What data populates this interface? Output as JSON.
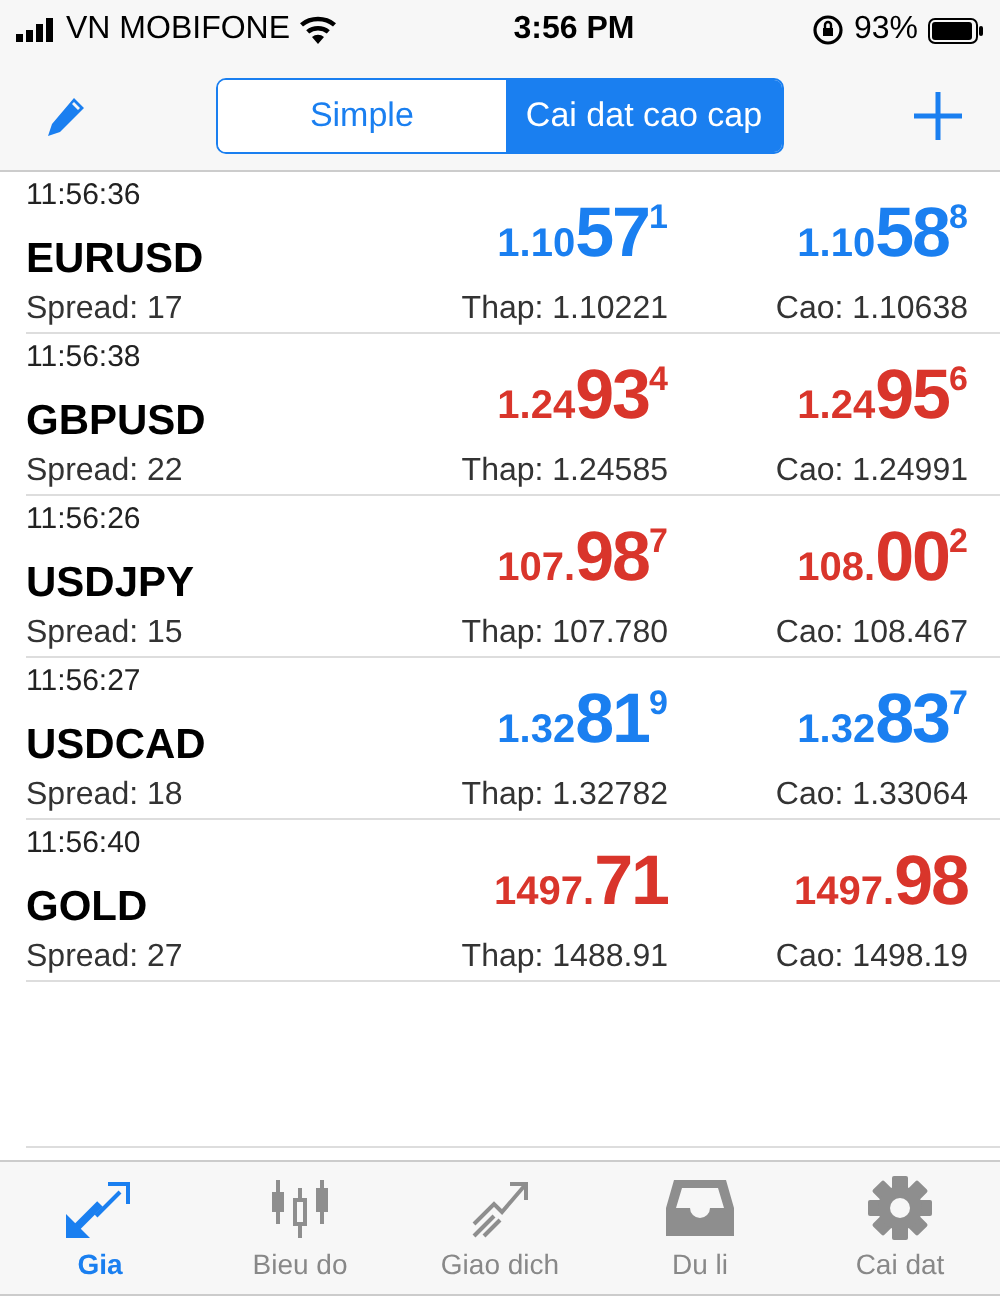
{
  "status_bar": {
    "carrier": "VN MOBIFONE",
    "time": "3:56 PM",
    "battery": "93%"
  },
  "toolbar": {
    "segments": [
      {
        "label": "Simple",
        "selected": false
      },
      {
        "label": "Cai dat cao cap",
        "selected": true
      }
    ]
  },
  "quotes": [
    {
      "time": "11:56:36",
      "symbol": "EURUSD",
      "spread": "Spread: 17",
      "color": "#1a7ff0",
      "bid": {
        "head": "1.10",
        "big": "57",
        "tail": "1"
      },
      "ask": {
        "head": "1.10",
        "big": "58",
        "tail": "8"
      },
      "low": "Thap: 1.10221",
      "high": "Cao: 1.10638"
    },
    {
      "time": "11:56:38",
      "symbol": "GBPUSD",
      "spread": "Spread: 22",
      "color": "#d9352b",
      "bid": {
        "head": "1.24",
        "big": "93",
        "tail": "4"
      },
      "ask": {
        "head": "1.24",
        "big": "95",
        "tail": "6"
      },
      "low": "Thap: 1.24585",
      "high": "Cao: 1.24991"
    },
    {
      "time": "11:56:26",
      "symbol": "USDJPY",
      "spread": "Spread: 15",
      "color": "#d9352b",
      "bid": {
        "head": "107.",
        "big": "98",
        "tail": "7"
      },
      "ask": {
        "head": "108.",
        "big": "00",
        "tail": "2"
      },
      "low": "Thap: 107.780",
      "high": "Cao: 108.467"
    },
    {
      "time": "11:56:27",
      "symbol": "USDCAD",
      "spread": "Spread: 18",
      "color": "#1a7ff0",
      "bid": {
        "head": "1.32",
        "big": "81",
        "tail": "9"
      },
      "ask": {
        "head": "1.32",
        "big": "83",
        "tail": "7"
      },
      "low": "Thap: 1.32782",
      "high": "Cao: 1.33064"
    },
    {
      "time": "11:56:40",
      "symbol": "GOLD",
      "spread": "Spread: 27",
      "color": "#d9352b",
      "bid": {
        "head": "1497.",
        "big": "71"
      },
      "ask": {
        "head": "1497.",
        "big": "98"
      },
      "low": "Thap: 1488.91",
      "high": "Cao: 1498.19"
    }
  ],
  "tab_bar": [
    {
      "label": "Gia",
      "kind": "quotes",
      "selected": true
    },
    {
      "label": "Bieu do",
      "kind": "chart",
      "selected": false
    },
    {
      "label": "Giao dich",
      "kind": "trade",
      "selected": false
    },
    {
      "label": "Du li",
      "kind": "history",
      "selected": false
    },
    {
      "label": "Cai dat",
      "kind": "settings",
      "selected": false
    }
  ]
}
